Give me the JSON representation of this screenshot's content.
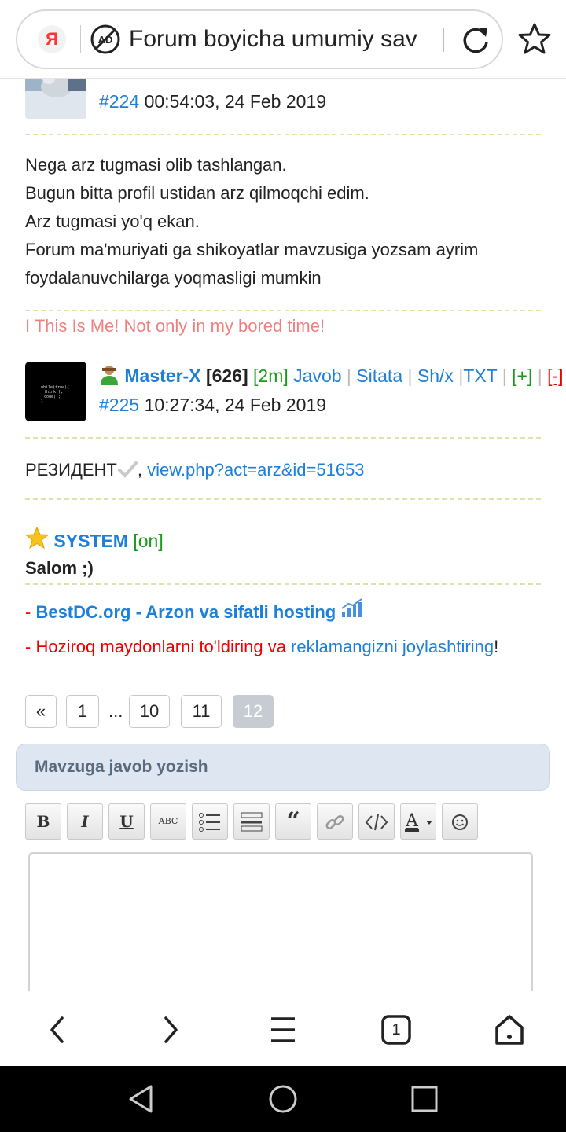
{
  "browser": {
    "brand_letter": "Я",
    "url_text": "Forum boyicha umumiy sav"
  },
  "post224": {
    "id": "#224",
    "time": "00:54:03, 24 Feb 2019",
    "message_lines": [
      "Nega arz tugmasi olib tashlangan.",
      "Bugun bitta profil ustidan arz qilmoqchi edim.",
      "Arz tugmasi yo'q ekan.",
      "Forum ma'muriyati ga shikoyatlar mavzusiga yozsam ayrim",
      "foydalanuvchilarga yoqmasligi mumkin"
    ],
    "signature": "I This Is Me! Not only in my bored time!"
  },
  "post225": {
    "username": "Master-X",
    "rating": "[626]",
    "online": "[2m]",
    "actions": [
      "Javob",
      "Sitata",
      "Sh/x",
      "TXT"
    ],
    "plus": "[+]",
    "minus": "[-]",
    "id": "#225",
    "time": "10:27:34, 24 Feb 2019",
    "message_prefix": "РЕЗИДЕНТ",
    "message_link": "view.php?act=arz&id=51653"
  },
  "system": {
    "username": "SYSTEM",
    "status": "[on]",
    "greeting": "Salom ;)",
    "ad1_dash": "- ",
    "ad1_link": "BestDC.org - Arzon va sifatli hosting",
    "ad2_dash": "- ",
    "ad2_part1": "Hoziroq maydonlarni to'ldiring",
    "ad2_va": " va ",
    "ad2_part2": "reklamangizni joylashtiring",
    "ad2_end": "!"
  },
  "pager": {
    "prev": "«",
    "pages": [
      "1",
      "10",
      "11",
      "12"
    ],
    "ellipsis": "...",
    "current": "12"
  },
  "reply": {
    "title": "Mavzuga javob yozish",
    "toolbar": [
      "B",
      "I",
      "U",
      "ABC",
      "list",
      "hr",
      "quote",
      "link",
      "code",
      "color",
      "smile"
    ]
  },
  "bottom_nav": {
    "tabs_count": "1"
  },
  "colors": {
    "link": "#1e7fd8",
    "green": "#1a9a1a",
    "red": "#e00000",
    "signature": "#f08080"
  }
}
